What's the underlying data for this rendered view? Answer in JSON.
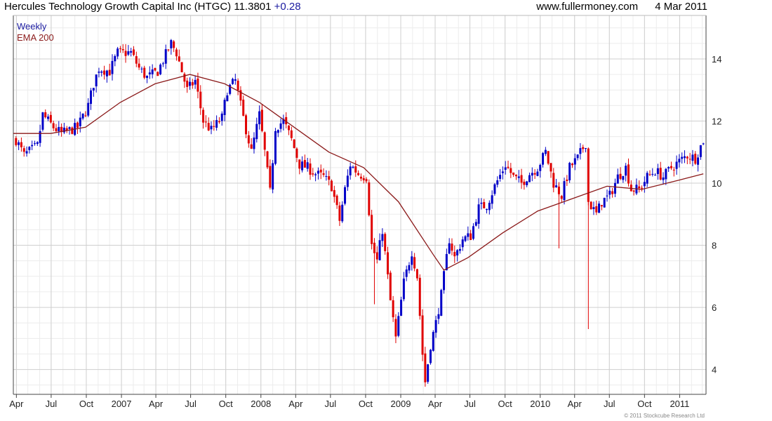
{
  "header": {
    "title": "Hercules Technology Growth Capital Inc (HTGC)",
    "price": "11.3801",
    "change": "+0.28",
    "source": "www.fullermoney.com",
    "date": "4 Mar 2011"
  },
  "copyright": "© 2011 Stockcube Research Ltd",
  "colors": {
    "up": "#0000c8",
    "down": "#e00000",
    "ema": "#8b1a1a",
    "grid": "#cfcfcf",
    "legend_weekly": "#1a1aa0",
    "legend_ema": "#8b1a1a"
  },
  "chart_data": {
    "type": "candlestick",
    "title": "Hercules Technology Growth Capital Inc (HTGC)",
    "legend": [
      "Weekly",
      "EMA 200"
    ],
    "legend_position": "top-left",
    "ylim": [
      3.2,
      15.4
    ],
    "yticks": [
      4,
      6,
      8,
      10,
      12,
      14
    ],
    "xlim": [
      "2006-03-24",
      "2011-03-11"
    ],
    "xticks": [
      {
        "date": "2006-04-01",
        "label": "Apr"
      },
      {
        "date": "2006-07-01",
        "label": "Jul"
      },
      {
        "date": "2006-10-01",
        "label": "Oct"
      },
      {
        "date": "2007-01-01",
        "label": "2007"
      },
      {
        "date": "2007-04-01",
        "label": "Apr"
      },
      {
        "date": "2007-07-01",
        "label": "Jul"
      },
      {
        "date": "2007-10-01",
        "label": "Oct"
      },
      {
        "date": "2008-01-01",
        "label": "2008"
      },
      {
        "date": "2008-04-01",
        "label": "Apr"
      },
      {
        "date": "2008-07-01",
        "label": "Jul"
      },
      {
        "date": "2008-10-01",
        "label": "Oct"
      },
      {
        "date": "2009-01-01",
        "label": "2009"
      },
      {
        "date": "2009-04-01",
        "label": "Apr"
      },
      {
        "date": "2009-07-01",
        "label": "Jul"
      },
      {
        "date": "2009-10-01",
        "label": "Oct"
      },
      {
        "date": "2010-01-01",
        "label": "2010"
      },
      {
        "date": "2010-04-01",
        "label": "Apr"
      },
      {
        "date": "2010-07-01",
        "label": "Jul"
      },
      {
        "date": "2010-10-01",
        "label": "Oct"
      },
      {
        "date": "2011-01-01",
        "label": "2011"
      }
    ],
    "grid": true,
    "close_path": [
      [
        "2006-03-31",
        11.4
      ],
      [
        "2006-04-21",
        10.9
      ],
      [
        "2006-05-26",
        11.2
      ],
      [
        "2006-06-09",
        12.2
      ],
      [
        "2006-07-07",
        11.8
      ],
      [
        "2006-07-28",
        11.6
      ],
      [
        "2006-09-08",
        11.8
      ],
      [
        "2006-10-06",
        12.5
      ],
      [
        "2006-10-20",
        13.2
      ],
      [
        "2006-11-03",
        13.7
      ],
      [
        "2006-12-01",
        13.6
      ],
      [
        "2006-12-22",
        14.2
      ],
      [
        "2007-01-26",
        14.2
      ],
      [
        "2007-02-16",
        13.7
      ],
      [
        "2007-03-09",
        13.4
      ],
      [
        "2007-04-06",
        13.6
      ],
      [
        "2007-05-11",
        14.5
      ],
      [
        "2007-05-25",
        14.2
      ],
      [
        "2007-06-08",
        13.6
      ],
      [
        "2007-06-22",
        13.0
      ],
      [
        "2007-07-13",
        13.3
      ],
      [
        "2007-08-03",
        12.0
      ],
      [
        "2007-08-24",
        11.7
      ],
      [
        "2007-09-21",
        12.1
      ],
      [
        "2007-10-05",
        13.0
      ],
      [
        "2007-10-26",
        13.3
      ],
      [
        "2007-11-16",
        12.1
      ],
      [
        "2007-12-07",
        11.0
      ],
      [
        "2007-12-28",
        12.2
      ],
      [
        "2008-01-11",
        11.0
      ],
      [
        "2008-01-25",
        9.7
      ],
      [
        "2008-02-08",
        11.8
      ],
      [
        "2008-02-29",
        12.0
      ],
      [
        "2008-03-21",
        11.4
      ],
      [
        "2008-04-11",
        10.6
      ],
      [
        "2008-05-02",
        10.5
      ],
      [
        "2008-05-23",
        10.3
      ],
      [
        "2008-06-13",
        10.2
      ],
      [
        "2008-07-04",
        9.9
      ],
      [
        "2008-07-25",
        8.8
      ],
      [
        "2008-08-08",
        9.8
      ],
      [
        "2008-08-22",
        10.6
      ],
      [
        "2008-09-12",
        10.3
      ],
      [
        "2008-10-03",
        10.2
      ],
      [
        "2008-10-17",
        8.0
      ],
      [
        "2008-10-31",
        7.5
      ],
      [
        "2008-11-14",
        8.5
      ],
      [
        "2008-12-05",
        6.2
      ],
      [
        "2008-12-19",
        5.0
      ],
      [
        "2009-01-09",
        6.8
      ],
      [
        "2009-01-30",
        7.8
      ],
      [
        "2009-02-13",
        7.0
      ],
      [
        "2009-02-27",
        4.5
      ],
      [
        "2009-03-06",
        3.6
      ],
      [
        "2009-03-20",
        4.8
      ],
      [
        "2009-04-03",
        5.5
      ],
      [
        "2009-04-17",
        6.4
      ],
      [
        "2009-05-08",
        8.2
      ],
      [
        "2009-05-22",
        7.6
      ],
      [
        "2009-06-12",
        8.2
      ],
      [
        "2009-07-03",
        8.3
      ],
      [
        "2009-07-24",
        9.2
      ],
      [
        "2009-08-14",
        9.3
      ],
      [
        "2009-09-04",
        9.9
      ],
      [
        "2009-10-02",
        10.6
      ],
      [
        "2009-10-23",
        10.2
      ],
      [
        "2009-11-13",
        10.0
      ],
      [
        "2009-12-04",
        10.3
      ],
      [
        "2009-12-25",
        10.5
      ],
      [
        "2010-01-15",
        11.0
      ],
      [
        "2010-02-05",
        10.0
      ],
      [
        "2010-02-26",
        9.6
      ],
      [
        "2010-03-19",
        10.5
      ],
      [
        "2010-04-09",
        10.8
      ],
      [
        "2010-04-30",
        11.3
      ],
      [
        "2010-05-07",
        9.4
      ],
      [
        "2010-05-28",
        9.0
      ],
      [
        "2010-06-11",
        9.4
      ],
      [
        "2010-07-02",
        9.6
      ],
      [
        "2010-07-23",
        10.2
      ],
      [
        "2010-08-13",
        10.5
      ],
      [
        "2010-08-27",
        9.8
      ],
      [
        "2010-09-17",
        9.8
      ],
      [
        "2010-10-08",
        10.2
      ],
      [
        "2010-10-29",
        10.4
      ],
      [
        "2010-11-19",
        10.2
      ],
      [
        "2010-12-10",
        10.5
      ],
      [
        "2010-12-31",
        10.7
      ],
      [
        "2011-01-21",
        10.9
      ],
      [
        "2011-02-11",
        10.8
      ],
      [
        "2011-03-04",
        11.38
      ]
    ],
    "spikes": [
      {
        "date": "2008-10-24",
        "low": 6.1
      },
      {
        "date": "2010-02-19",
        "low": 7.9
      },
      {
        "date": "2010-05-07",
        "low": 5.3
      }
    ],
    "ema_200": [
      [
        "2006-03-24",
        11.6
      ],
      [
        "2006-06-30",
        11.6
      ],
      [
        "2006-09-29",
        11.8
      ],
      [
        "2006-12-29",
        12.6
      ],
      [
        "2007-03-30",
        13.2
      ],
      [
        "2007-06-29",
        13.5
      ],
      [
        "2007-09-28",
        13.2
      ],
      [
        "2007-12-28",
        12.6
      ],
      [
        "2008-03-28",
        11.8
      ],
      [
        "2008-06-27",
        11.0
      ],
      [
        "2008-09-26",
        10.5
      ],
      [
        "2008-12-26",
        9.4
      ],
      [
        "2009-03-27",
        7.7
      ],
      [
        "2009-04-24",
        7.2
      ],
      [
        "2009-06-26",
        7.6
      ],
      [
        "2009-09-25",
        8.4
      ],
      [
        "2009-12-25",
        9.1
      ],
      [
        "2010-03-26",
        9.5
      ],
      [
        "2010-06-25",
        9.9
      ],
      [
        "2010-09-24",
        9.8
      ],
      [
        "2010-12-31",
        10.1
      ],
      [
        "2011-03-04",
        10.3
      ]
    ]
  }
}
